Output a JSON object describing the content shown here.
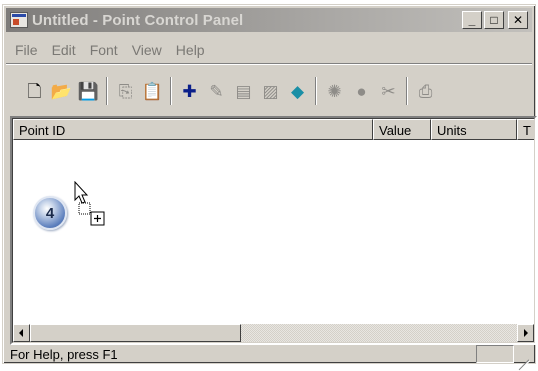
{
  "window": {
    "title": "Untitled - Point Control Panel",
    "minimize_glyph": "_",
    "maximize_glyph": "□",
    "close_glyph": "✕"
  },
  "menu": [
    "File",
    "Edit",
    "Font",
    "View",
    "Help"
  ],
  "toolbar": {
    "groups": [
      [
        "new-icon",
        "open-icon",
        "save-icon"
      ],
      [
        "copy-icon",
        "paste-icon"
      ],
      [
        "add-point-icon",
        "edit-point-icon",
        "point-list-icon",
        "properties-icon",
        "connect-icon"
      ],
      [
        "monitor-icon",
        "point-status-icon",
        "cut-icon"
      ],
      [
        "print-icon"
      ]
    ],
    "glyphs": {
      "new-icon": "🗋",
      "open-icon": "📂",
      "save-icon": "💾",
      "copy-icon": "⎘",
      "paste-icon": "📋",
      "add-point-icon": "✚",
      "edit-point-icon": "✎",
      "point-list-icon": "▤",
      "properties-icon": "▨",
      "connect-icon": "◆",
      "monitor-icon": "✺",
      "point-status-icon": "●",
      "cut-icon": "✂",
      "print-icon": "⎙"
    },
    "disabled": [
      "copy-icon",
      "paste-icon",
      "edit-point-icon",
      "point-list-icon",
      "properties-icon",
      "monitor-icon",
      "point-status-icon",
      "cut-icon",
      "print-icon"
    ]
  },
  "list": {
    "columns": [
      "Point ID",
      "Value",
      "Units",
      "T"
    ],
    "rows": []
  },
  "callout": {
    "number": "4"
  },
  "status": {
    "text": "For Help, press F1"
  },
  "colors": {
    "face": "#d4d0c8",
    "title_gradient_start": "#7e7c7a",
    "title_text": "#d8d6d2",
    "menu_text_disabled": "#7a7874",
    "add_point": "#0b1f8a",
    "connect": "#1a8fa6"
  }
}
